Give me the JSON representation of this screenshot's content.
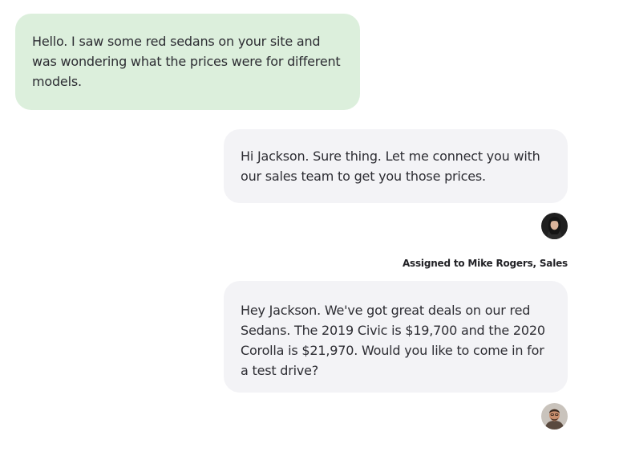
{
  "conversation": {
    "messages": [
      {
        "sender": "customer",
        "text": "Hello. I saw some red sedans on your site and was wondering what the prices were for different models."
      },
      {
        "sender": "agent",
        "text": "Hi Jackson. Sure thing. Let me connect you with our sales team to get you those prices."
      },
      {
        "sender": "agent",
        "text": "Hey Jackson. We've got great deals on our red Sedans. The 2019 Civic is $19,700 and the 2020 Corolla is $21,970. Would you like to come in for a test drive?"
      }
    ],
    "assignment_notice": "Assigned to Mike Rogers, Sales",
    "avatars": [
      {
        "icon": "agent-avatar-woman-icon"
      },
      {
        "icon": "agent-avatar-man-icon"
      }
    ],
    "colors": {
      "customer_bubble": "#dcefdc",
      "agent_bubble": "#f3f3f6",
      "text": "#2d2d33"
    }
  }
}
